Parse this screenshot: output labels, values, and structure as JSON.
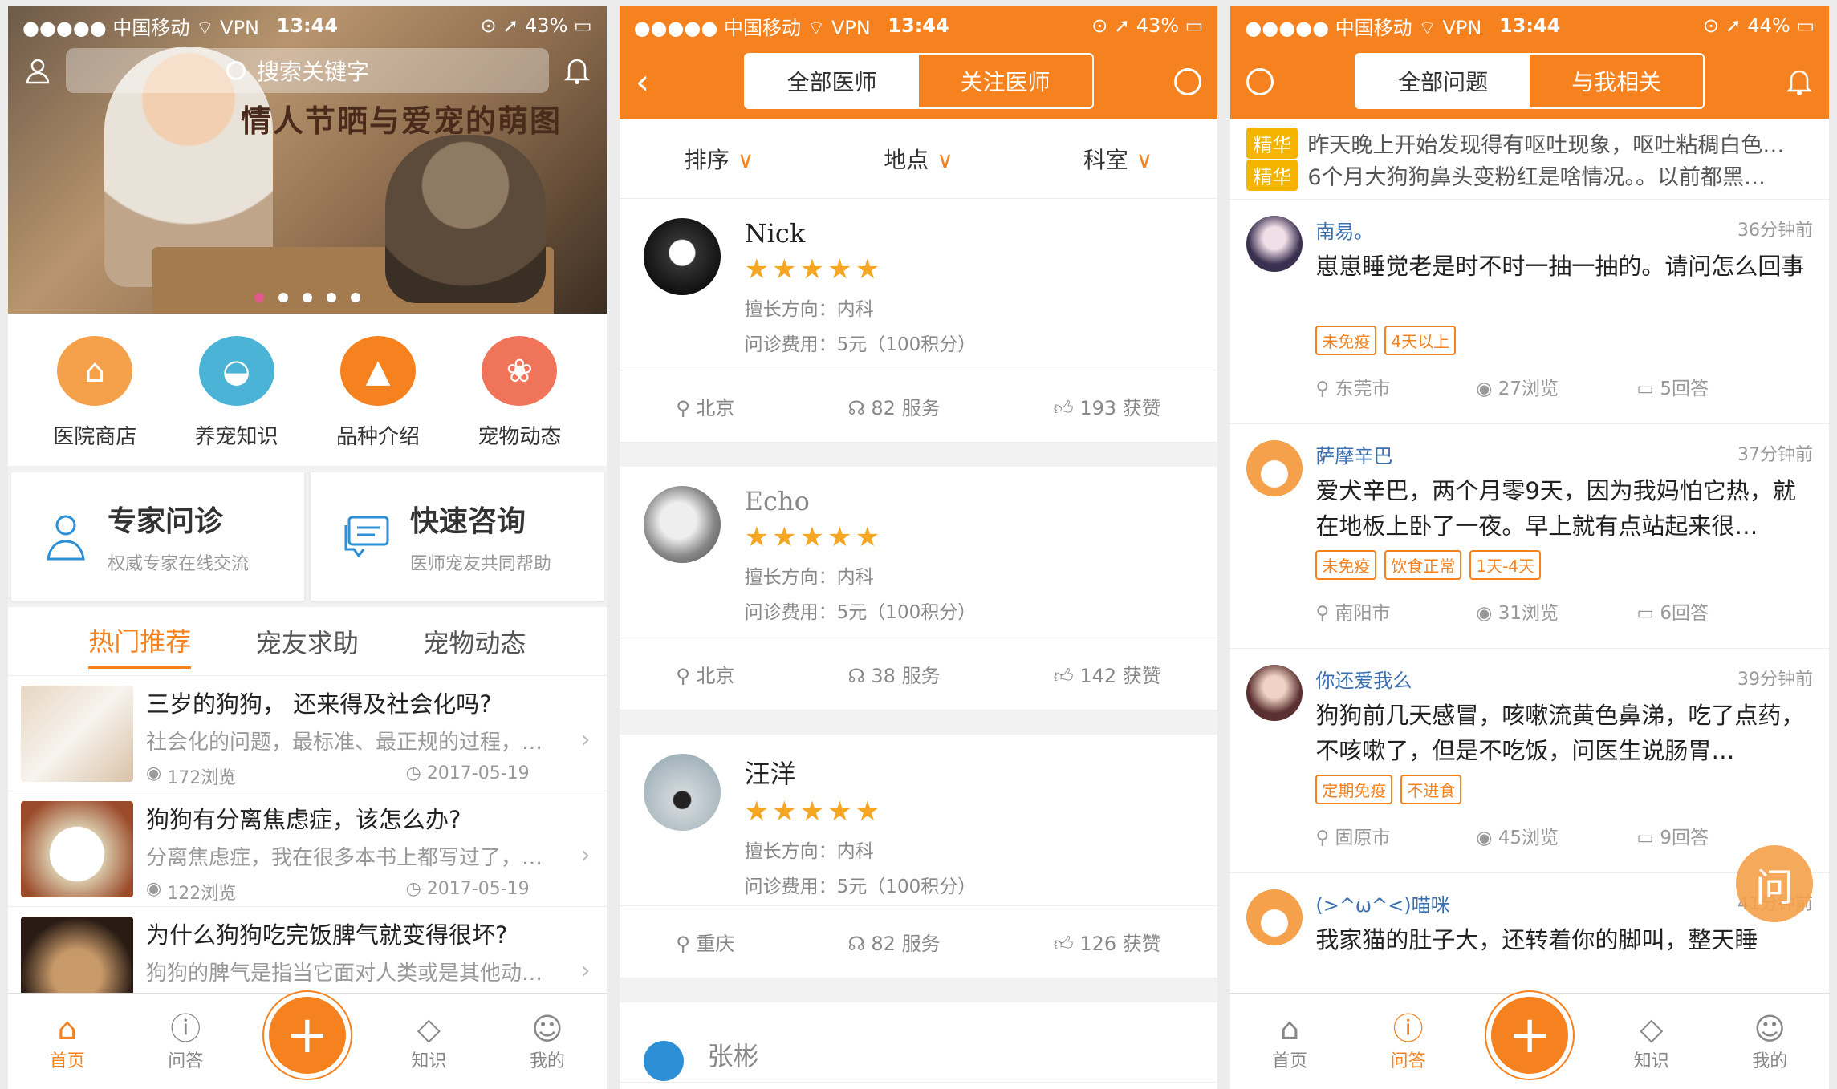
{
  "status1": {
    "carrier": "●●●●● 中国移动 ⌔ VPN",
    "time": "13:44",
    "right": "⊙ ➚ 43% ▭"
  },
  "status2": {
    "carrier": "●●●●● 中国移动 ⌔ VPN",
    "time": "13:44",
    "right": "⊙ ➚ 43% ▭"
  },
  "status3": {
    "carrier": "●●●●● 中国移动 ⌔ VPN",
    "time": "13:44",
    "right": "⊙ ➚ 44% ▭"
  },
  "home": {
    "search_placeholder": "搜索关键字",
    "banner_title": "情人节晒与爱宠的萌图",
    "categories": [
      {
        "label": "医院商店",
        "color": "#f5a04a",
        "icon": "store-icon"
      },
      {
        "label": "养宠知识",
        "color": "#4ab3d6",
        "icon": "collar-icon"
      },
      {
        "label": "品种介绍",
        "color": "#f5821f",
        "icon": "cats-icon"
      },
      {
        "label": "宠物动态",
        "color": "#f0745a",
        "icon": "paw-icon"
      }
    ],
    "services": [
      {
        "title": "专家问诊",
        "sub": "权威专家在线交流"
      },
      {
        "title": "快速咨询",
        "sub": "医师宠友共同帮助"
      }
    ],
    "tabs": [
      "热门推荐",
      "宠友求助",
      "宠物动态"
    ],
    "articles": [
      {
        "title": "三岁的狗狗， 还来得及社会化吗?",
        "excerpt": "社会化的问题，最标准、最正规的过程，…",
        "views": "172浏览",
        "date": "2017-05-19"
      },
      {
        "title": "狗狗有分离焦虑症，该怎么办?",
        "excerpt": "分离焦虑症，我在很多本书上都写过了，…",
        "views": "122浏览",
        "date": "2017-05-19"
      },
      {
        "title": "为什么狗狗吃完饭脾气就变得很坏?",
        "excerpt": "狗狗的脾气是指当它面对人类或是其他动…",
        "views": "",
        "date": ""
      }
    ]
  },
  "tabbar": {
    "home": "首页",
    "qa": "问答",
    "knowledge": "知识",
    "mine": "我的",
    "plus": "+"
  },
  "doctors": {
    "seg": [
      "全部医师",
      "关注医师"
    ],
    "filters": [
      "排序",
      "地点",
      "科室"
    ],
    "list": [
      {
        "name": "Nick",
        "stars": "★★★★★",
        "field": "擅长方向：内科",
        "fee": "问诊费用：5元（100积分）",
        "city": "北京",
        "services": "82 服务",
        "likes": "193 获赞"
      },
      {
        "name": "Echo",
        "stars": "★★★★★",
        "field": "擅长方向：内科",
        "fee": "问诊费用：5元（100积分）",
        "city": "北京",
        "services": "38 服务",
        "likes": "142 获赞"
      },
      {
        "name": "汪洋",
        "stars": "★★★★★",
        "field": "擅长方向：内科",
        "fee": "问诊费用：5元（100积分）",
        "city": "重庆",
        "services": "82 服务",
        "likes": "126 获赞"
      },
      {
        "name": "张彬"
      }
    ]
  },
  "qa": {
    "seg": [
      "全部问题",
      "与我相关"
    ],
    "featured_tag": "精华",
    "featured": [
      "昨天晚上开始发现得有呕吐现象，呕吐粘稠白色…",
      "6个月大狗狗鼻头变粉红是啥情况。。以前都黑…"
    ],
    "questions": [
      {
        "user": "南易。",
        "time": "36分钟前",
        "text": "崽崽睡觉老是时不时一抽一抽的。请问怎么回事",
        "tags": [
          "未免疫",
          "4天以上"
        ],
        "city": "东莞市",
        "views": "27浏览",
        "answers": "5回答"
      },
      {
        "user": "萨摩辛巴",
        "time": "37分钟前",
        "text": "爱犬辛巴，两个月零9天，因为我妈怕它热，就在地板上卧了一夜。早上就有点站起来很…",
        "tags": [
          "未免疫",
          "饮食正常",
          "1天-4天"
        ],
        "city": "南阳市",
        "views": "31浏览",
        "answers": "6回答"
      },
      {
        "user": "你还爱我么",
        "time": "39分钟前",
        "text": "狗狗前几天感冒，咳嗽流黄色鼻涕，吃了点药，不咳嗽了，但是不吃饭，问医生说肠胃…",
        "tags": [
          "定期免疫",
          "不进食"
        ],
        "city": "固原市",
        "views": "45浏览",
        "answers": "9回答"
      },
      {
        "user": "(>^ω^<)喵咪",
        "time": "41分钟前",
        "text": "我家猫的肚子大，还转着你的脚叫，整天睡",
        "tags": [],
        "city": "",
        "views": "",
        "answers": ""
      }
    ],
    "fab": "问"
  },
  "colors": {
    "accent": "#f5821f",
    "star": "#f5a623",
    "link": "#3a6fb0"
  }
}
